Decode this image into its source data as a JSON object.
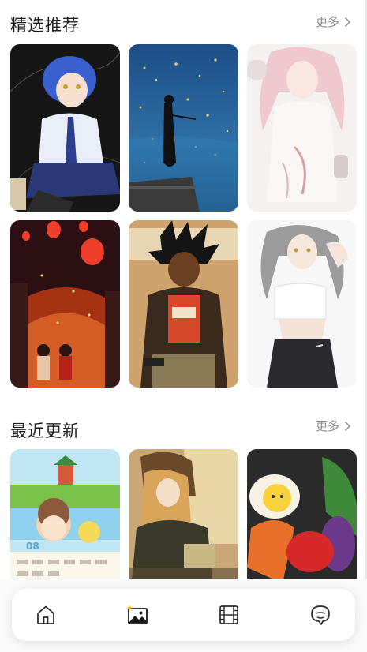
{
  "sections": {
    "featured": {
      "title": "精选推荐",
      "more": "更多"
    },
    "latest": {
      "title": "最近更新",
      "more": "更多"
    }
  },
  "featured_cards": [
    {
      "icon": "anime-girl-blue-hair-image"
    },
    {
      "icon": "violinist-night-city-image"
    },
    {
      "icon": "white-dress-girl-image"
    },
    {
      "icon": "lantern-festival-image"
    },
    {
      "icon": "spiky-hair-warrior-image"
    },
    {
      "icon": "silver-hair-girl-image"
    }
  ],
  "latest_cards": [
    {
      "icon": "cartoon-calendar-image",
      "calendar_number": "08"
    },
    {
      "icon": "reading-girl-image"
    },
    {
      "icon": "plush-vegetables-image"
    }
  ],
  "nav": [
    {
      "icon": "home-icon"
    },
    {
      "icon": "gallery-icon",
      "active": true
    },
    {
      "icon": "film-icon"
    },
    {
      "icon": "chat-icon"
    }
  ],
  "colors": {
    "accent": "#1a1a1a",
    "more_text": "#8a8a8a",
    "active_sparkle": "#f0b400"
  }
}
